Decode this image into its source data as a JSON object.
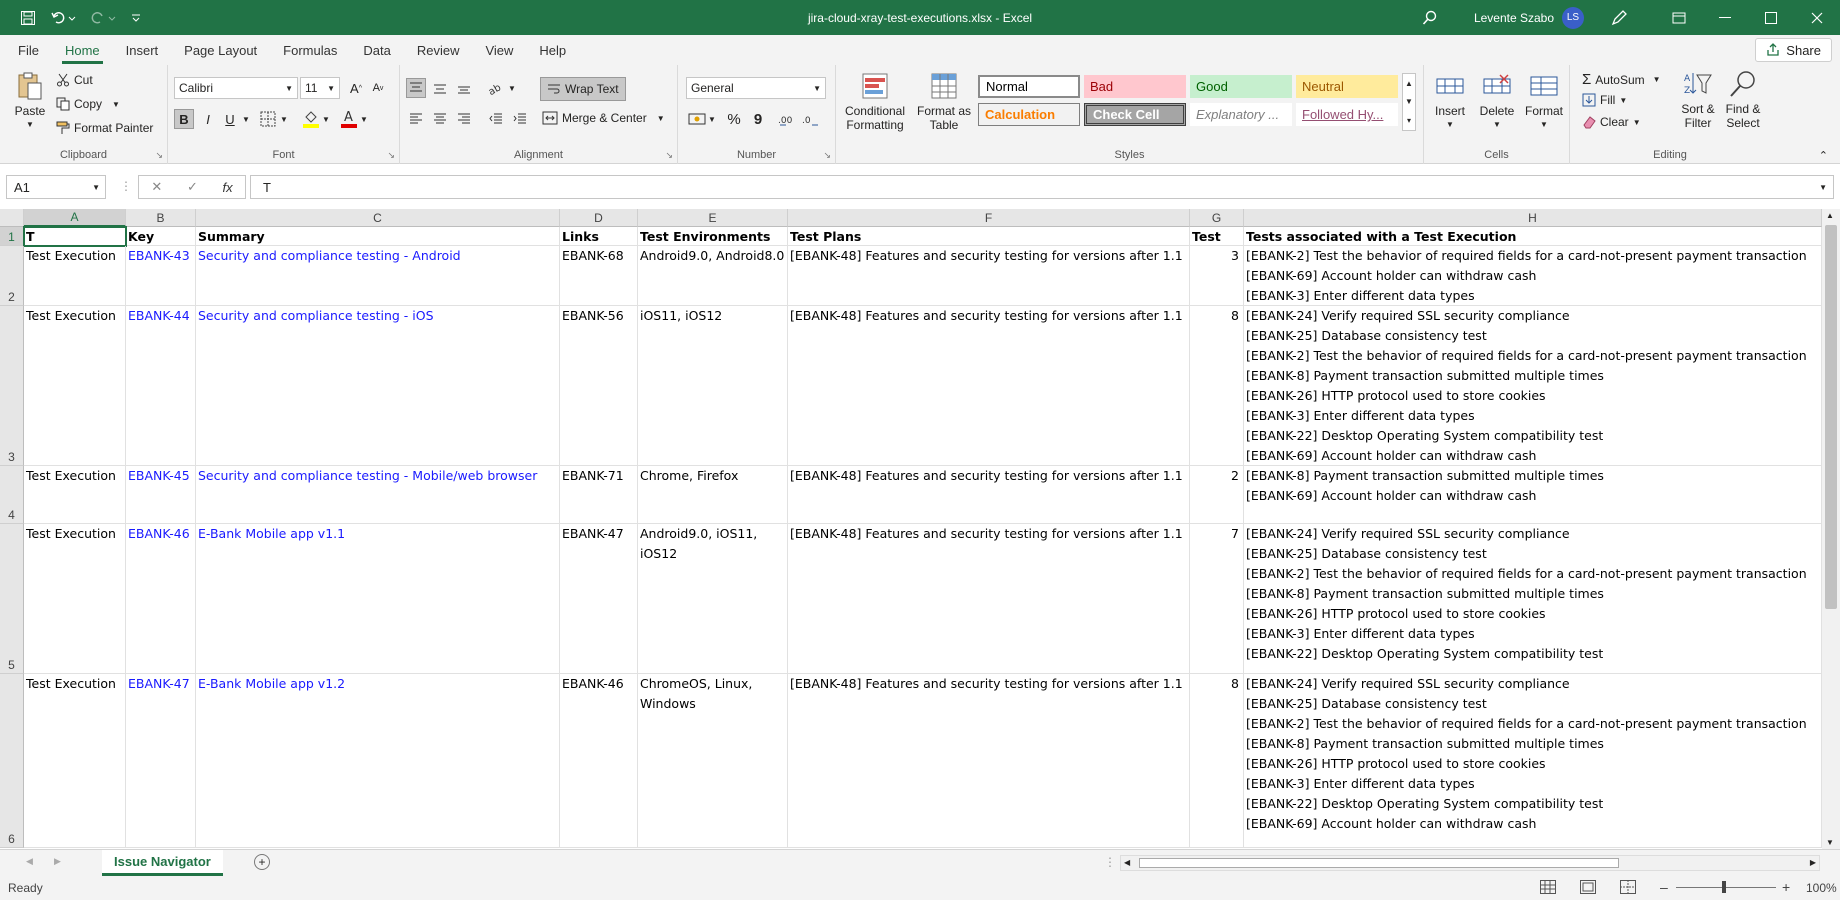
{
  "window": {
    "title": "jira-cloud-xray-test-executions.xlsx  -  Excel",
    "user_name": "Levente Szabo",
    "user_initials": "LS"
  },
  "menu": {
    "tabs": [
      "File",
      "Home",
      "Insert",
      "Page Layout",
      "Formulas",
      "Data",
      "Review",
      "View",
      "Help"
    ],
    "active": "Home",
    "share_label": "Share"
  },
  "ribbon": {
    "clipboard": {
      "paste": "Paste",
      "cut": "Cut",
      "copy": "Copy",
      "format_painter": "Format Painter",
      "label": "Clipboard"
    },
    "font": {
      "name": "Calibri",
      "size": "11",
      "label": "Font",
      "bold": "B",
      "italic": "I",
      "underline": "U"
    },
    "alignment": {
      "wrap_text": "Wrap Text",
      "merge_center": "Merge & Center",
      "label": "Alignment"
    },
    "number": {
      "format": "General",
      "label": "Number",
      "percent": "%",
      "comma": "9"
    },
    "styles": {
      "conditional_formatting": "Conditional Formatting",
      "format_as_table": "Format as Table",
      "label": "Styles",
      "cells": [
        {
          "name": "Normal",
          "bg": "#ffffff",
          "color": "#000000"
        },
        {
          "name": "Bad",
          "bg": "#ffc7ce",
          "color": "#9c0006"
        },
        {
          "name": "Good",
          "bg": "#c6efce",
          "color": "#006100"
        },
        {
          "name": "Neutral",
          "bg": "#ffeb9c",
          "color": "#9c5700"
        },
        {
          "name": "Calculation",
          "bg": "#f2f2f2",
          "color": "#fa7d00"
        },
        {
          "name": "Check Cell",
          "bg": "#a5a5a5",
          "color": "#ffffff"
        },
        {
          "name": "Explanatory ...",
          "bg": "#ffffff",
          "color": "#7f7f7f"
        },
        {
          "name": "Followed Hy...",
          "bg": "#ffffff",
          "color": "#954f72"
        }
      ]
    },
    "cells": {
      "insert": "Insert",
      "delete": "Delete",
      "format": "Format",
      "label": "Cells"
    },
    "editing": {
      "autosum": "AutoSum",
      "fill": "Fill",
      "clear": "Clear",
      "sort_filter": "Sort & Filter",
      "find_select": "Find & Select",
      "label": "Editing"
    }
  },
  "formula_bar": {
    "name_box": "A1",
    "fx": "fx",
    "value": "T"
  },
  "sheet": {
    "columns": [
      "A",
      "B",
      "C",
      "D",
      "E",
      "F",
      "G",
      "H"
    ],
    "header_row": [
      "T",
      "Key",
      "Summary",
      "Links",
      "Test Environments",
      "Test Plans",
      "Test",
      "Tests associated with a Test Execution"
    ],
    "rows": [
      {
        "num": "2",
        "type": "Test Execution",
        "key": "EBANK-43",
        "summary": "Security and compliance testing - Android",
        "links": "EBANK-68",
        "env": [
          "Android9.0, Android8.0"
        ],
        "plan": "[EBANK-48] Features and security testing for versions after 1.1",
        "count": "3",
        "tests": [
          "[EBANK-2] Test the behavior of required fields for a card-not-present payment transaction",
          "[EBANK-69] Account holder can withdraw cash",
          "[EBANK-3] Enter different data types"
        ]
      },
      {
        "num": "3",
        "type": "Test Execution",
        "key": "EBANK-44",
        "summary": "Security and compliance testing - iOS",
        "links": "EBANK-56",
        "env": [
          "iOS11, iOS12"
        ],
        "plan": "[EBANK-48] Features and security testing for versions after 1.1",
        "count": "8",
        "tests": [
          "[EBANK-24] Verify required SSL security compliance",
          "[EBANK-25] Database consistency test",
          "[EBANK-2] Test the behavior of required fields for a card-not-present payment transaction",
          "[EBANK-8] Payment transaction submitted multiple times",
          "[EBANK-26] HTTP protocol used to store cookies",
          "[EBANK-3] Enter different data types",
          "[EBANK-22] Desktop Operating System compatibility test",
          "[EBANK-69] Account holder can withdraw cash"
        ]
      },
      {
        "num": "4",
        "type": "Test Execution",
        "key": "EBANK-45",
        "summary": "Security and compliance testing - Mobile/web browser",
        "links": "EBANK-71",
        "env": [
          "Chrome, Firefox"
        ],
        "plan": "[EBANK-48] Features and security testing for versions after 1.1",
        "count": "2",
        "tests": [
          "[EBANK-8] Payment transaction submitted multiple times",
          "[EBANK-69] Account holder can withdraw cash"
        ]
      },
      {
        "num": "5",
        "type": "Test Execution",
        "key": "EBANK-46",
        "summary": "E-Bank Mobile app v1.1",
        "links": "EBANK-47",
        "env": [
          "Android9.0, iOS11,",
          "iOS12"
        ],
        "plan": "[EBANK-48] Features and security testing for versions after 1.1",
        "count": "7",
        "tests": [
          "[EBANK-24] Verify required SSL security compliance",
          "[EBANK-25] Database consistency test",
          "[EBANK-2] Test the behavior of required fields for a card-not-present payment transaction",
          "[EBANK-8] Payment transaction submitted multiple times",
          "[EBANK-26] HTTP protocol used to store cookies",
          "[EBANK-3] Enter different data types",
          "[EBANK-22] Desktop Operating System compatibility test"
        ]
      },
      {
        "num": "6",
        "type": "Test Execution",
        "key": "EBANK-47",
        "summary": "E-Bank Mobile app v1.2",
        "links": "EBANK-46",
        "env": [
          "ChromeOS, Linux,",
          "Windows"
        ],
        "plan": "[EBANK-48] Features and security testing for versions after 1.1",
        "count": "8",
        "tests": [
          "[EBANK-24] Verify required SSL security compliance",
          "[EBANK-25] Database consistency test",
          "[EBANK-2] Test the behavior of required fields for a card-not-present payment transaction",
          "[EBANK-8] Payment transaction submitted multiple times",
          "[EBANK-26] HTTP protocol used to store cookies",
          "[EBANK-3] Enter different data types",
          "[EBANK-22] Desktop Operating System compatibility test",
          "[EBANK-69] Account holder can withdraw cash"
        ]
      }
    ]
  },
  "sheet_tabs": {
    "active": "Issue Navigator"
  },
  "status": {
    "ready": "Ready",
    "zoom": "100%"
  },
  "colors": {
    "accent": "#217346",
    "link": "#1a1aff"
  }
}
